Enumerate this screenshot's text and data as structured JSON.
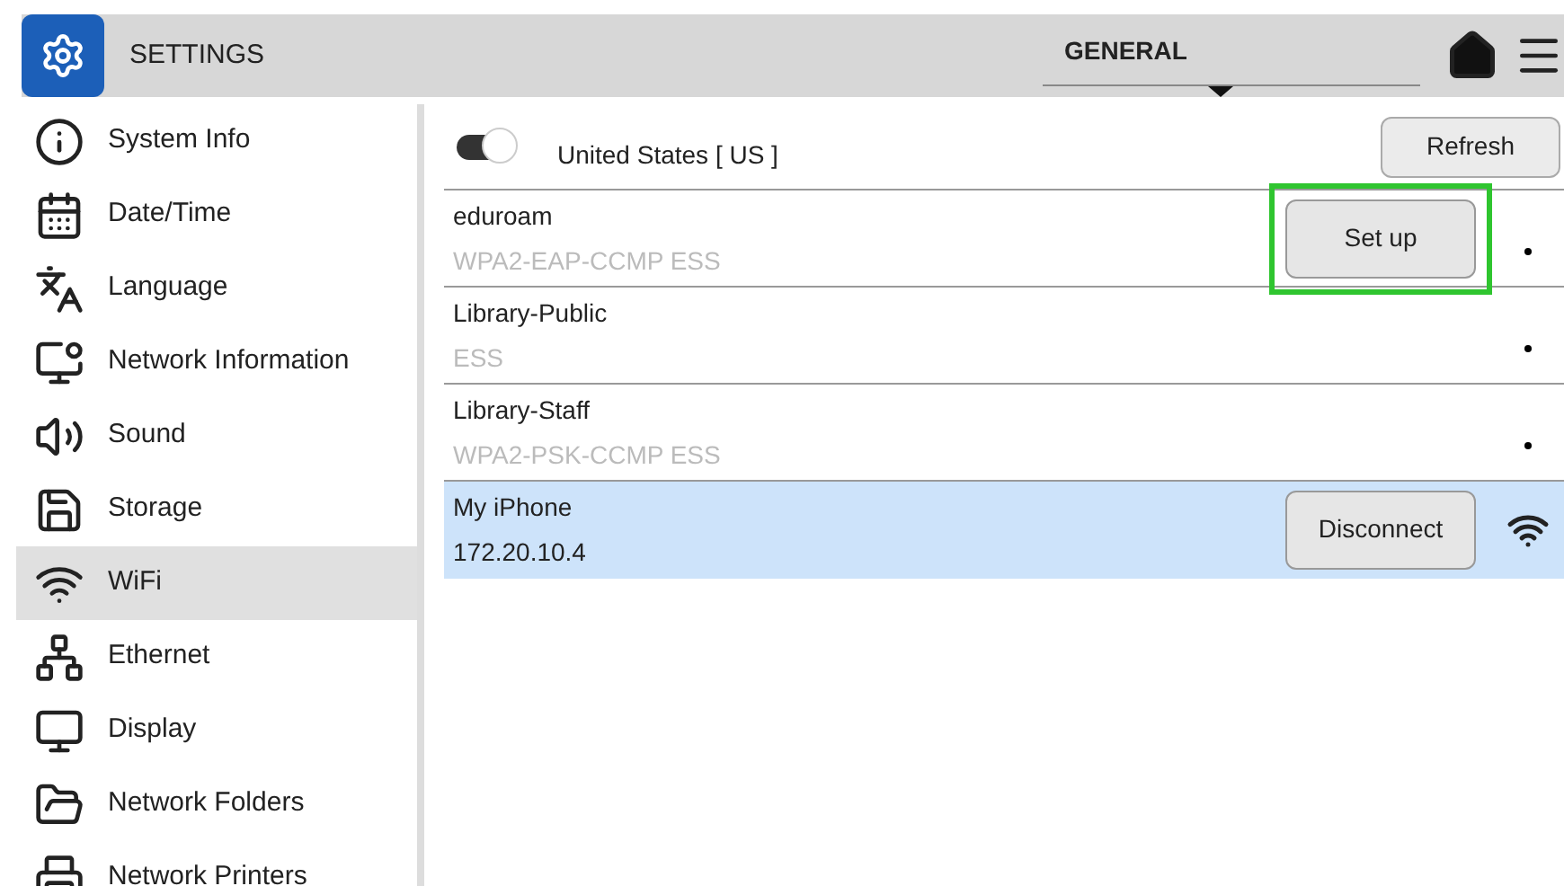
{
  "header": {
    "title": "SETTINGS",
    "tab": "GENERAL"
  },
  "sidebar": {
    "items": [
      {
        "label": "System Info",
        "selected": false
      },
      {
        "label": "Date/Time",
        "selected": false
      },
      {
        "label": "Language",
        "selected": false
      },
      {
        "label": "Network Information",
        "selected": false
      },
      {
        "label": "Sound",
        "selected": false
      },
      {
        "label": "Storage",
        "selected": false
      },
      {
        "label": "WiFi",
        "selected": true
      },
      {
        "label": "Ethernet",
        "selected": false
      },
      {
        "label": "Display",
        "selected": false
      },
      {
        "label": "Network Folders",
        "selected": false
      },
      {
        "label": "Network Printers",
        "selected": false
      }
    ]
  },
  "wifi": {
    "on": true,
    "country": "United States [ US ]",
    "refresh": "Refresh",
    "networks": [
      {
        "name": "eduroam",
        "detail": "WPA2-EAP-CCMP ESS",
        "selected": false,
        "button": "Set up",
        "highlighted": true,
        "kind": "dot"
      },
      {
        "name": "Library-Public",
        "detail": "ESS",
        "selected": false,
        "kind": "dot"
      },
      {
        "name": "Library-Staff",
        "detail": "WPA2-PSK-CCMP ESS",
        "selected": false,
        "kind": "dot"
      },
      {
        "name": "My iPhone",
        "detail": "172.20.10.4",
        "selected": true,
        "button": "Disconnect",
        "highlighted": false,
        "kind": "wifi"
      }
    ]
  }
}
